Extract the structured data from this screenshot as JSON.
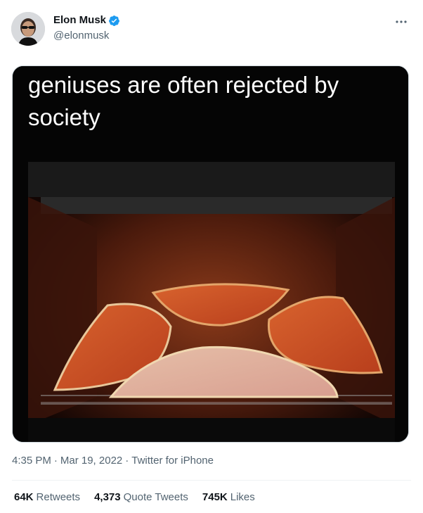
{
  "author": {
    "display_name": "Elon Musk",
    "handle": "@elonmusk",
    "verified": true,
    "verified_color": "#1d9bf0"
  },
  "media": {
    "caption_line1": "geniuses are often rejected by",
    "caption_line2": "society"
  },
  "meta": {
    "time": "4:35 PM",
    "date": "Mar 19, 2022",
    "source": "Twitter for iPhone",
    "separator": "·"
  },
  "stats": {
    "retweets_count": "64K",
    "retweets_label": "Retweets",
    "quotes_count": "4,373",
    "quotes_label": "Quote Tweets",
    "likes_count": "745K",
    "likes_label": "Likes"
  },
  "icons": {
    "verified": "verified-badge-icon",
    "more": "more-dots-icon"
  }
}
